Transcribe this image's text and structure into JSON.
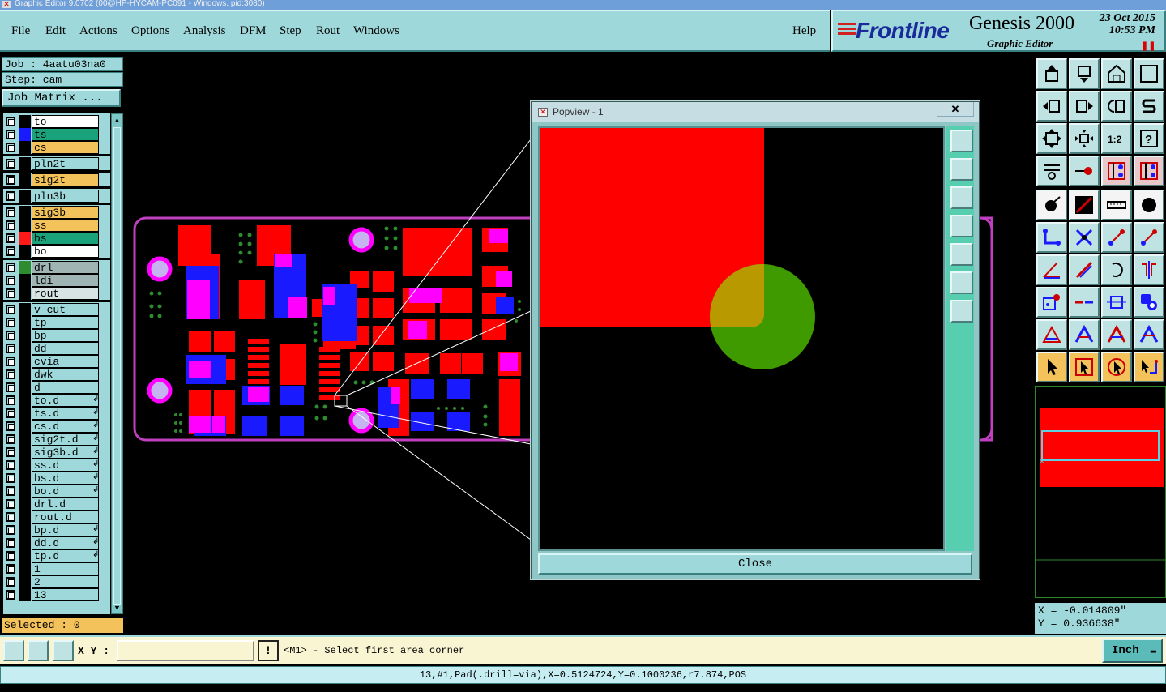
{
  "window": {
    "title": "Graphic Editor 9.0702 (00@HP-HYCAM-PC091 - Windows, pid:3080)"
  },
  "menu": [
    "File",
    "Edit",
    "Actions",
    "Options",
    "Analysis",
    "DFM",
    "Step",
    "Rout",
    "Windows"
  ],
  "help_label": "Help",
  "brand": {
    "logo": "Frontline",
    "product": "Genesis 2000",
    "subtitle": "Graphic Editor",
    "date": "23 Oct 2015",
    "time": "10:53 PM"
  },
  "job": {
    "job_label": "Job : 4aatu03na0",
    "step_label": "Step: cam",
    "job_matrix": "Job Matrix ..."
  },
  "layers": [
    {
      "name": "to",
      "color": "#ffffff",
      "swatch": "#000000"
    },
    {
      "name": "ts",
      "color": "#1aa27a",
      "swatch": "#1a1aff"
    },
    {
      "name": "cs",
      "color": "#f4c25a",
      "swatch": "#000000"
    },
    {
      "name": "pln2t",
      "color": "#9ed8da",
      "swatch": "#000000"
    },
    {
      "name": "sig2t",
      "color": "#f4c25a",
      "swatch": "#000000"
    },
    {
      "name": "pln3b",
      "color": "#9ed8da",
      "swatch": "#000000"
    },
    {
      "name": "sig3b",
      "color": "#f4c25a",
      "swatch": "#000000"
    },
    {
      "name": "ss",
      "color": "#f4c25a",
      "swatch": "#000000"
    },
    {
      "name": "bs",
      "color": "#1aa27a",
      "swatch": "#ff1a1a"
    },
    {
      "name": "bo",
      "color": "#ffffff",
      "swatch": "#000000"
    },
    {
      "name": "drl",
      "color": "#a0b4b4",
      "swatch": "#2e8b2e"
    },
    {
      "name": "ldi",
      "color": "#a0b4b4",
      "swatch": "#000000"
    },
    {
      "name": "rout",
      "color": "#d8e4e4",
      "swatch": "#000000"
    },
    {
      "name": "v-cut",
      "color": "#9ed8da",
      "swatch": "#000000"
    },
    {
      "name": "tp",
      "color": "#9ed8da",
      "swatch": "#000000"
    },
    {
      "name": "bp",
      "color": "#9ed8da",
      "swatch": "#000000"
    },
    {
      "name": "dd",
      "color": "#9ed8da",
      "swatch": "#000000"
    },
    {
      "name": "cvia",
      "color": "#9ed8da",
      "swatch": "#000000"
    },
    {
      "name": "dwk",
      "color": "#9ed8da",
      "swatch": "#000000"
    },
    {
      "name": "d",
      "color": "#9ed8da",
      "swatch": "#000000"
    },
    {
      "name": "to.d",
      "color": "#9ed8da",
      "swatch": "#000000",
      "mark": "↲"
    },
    {
      "name": "ts.d",
      "color": "#9ed8da",
      "swatch": "#000000",
      "mark": "↲"
    },
    {
      "name": "cs.d",
      "color": "#9ed8da",
      "swatch": "#000000",
      "mark": "↲"
    },
    {
      "name": "sig2t.d",
      "color": "#9ed8da",
      "swatch": "#000000",
      "mark": "↲"
    },
    {
      "name": "sig3b.d",
      "color": "#9ed8da",
      "swatch": "#000000",
      "mark": "↲"
    },
    {
      "name": "ss.d",
      "color": "#9ed8da",
      "swatch": "#000000",
      "mark": "↲"
    },
    {
      "name": "bs.d",
      "color": "#9ed8da",
      "swatch": "#000000",
      "mark": "↲"
    },
    {
      "name": "bo.d",
      "color": "#9ed8da",
      "swatch": "#000000",
      "mark": "↲"
    },
    {
      "name": "drl.d",
      "color": "#9ed8da",
      "swatch": "#000000"
    },
    {
      "name": "rout.d",
      "color": "#9ed8da",
      "swatch": "#000000"
    },
    {
      "name": "bp.d",
      "color": "#9ed8da",
      "swatch": "#000000",
      "mark": "↲"
    },
    {
      "name": "dd.d",
      "color": "#9ed8da",
      "swatch": "#000000",
      "mark": "↲"
    },
    {
      "name": "tp.d",
      "color": "#9ed8da",
      "swatch": "#000000",
      "mark": "↲"
    },
    {
      "name": "1",
      "color": "#9ed8da",
      "swatch": "#000000"
    },
    {
      "name": "2",
      "color": "#9ed8da",
      "swatch": "#000000"
    },
    {
      "name": "13",
      "color": "#9ed8da",
      "swatch": "#000000"
    }
  ],
  "selected_label": "Selected : 0",
  "popup": {
    "title": "Popview - 1",
    "close_label": "Close",
    "close_x": "✕"
  },
  "coords": {
    "x": "X = -0.014809\"",
    "y": "Y = 0.936638\""
  },
  "bottom": {
    "xy_label": "X Y :",
    "xy_value": "",
    "prompt": "<M1> - Select first area corner",
    "unit": "Inch",
    "warn": "!"
  },
  "status_line": "13,#1,Pad(.drill=via),X=0.5124724,Y=0.1000236,r7.874,POS",
  "colors": {
    "panel": "#9ed8da",
    "red": "#ff0000",
    "blue": "#1a1aff",
    "magenta": "#ff00ff",
    "green": "#2e8b2e",
    "outline": "#c040c0"
  }
}
